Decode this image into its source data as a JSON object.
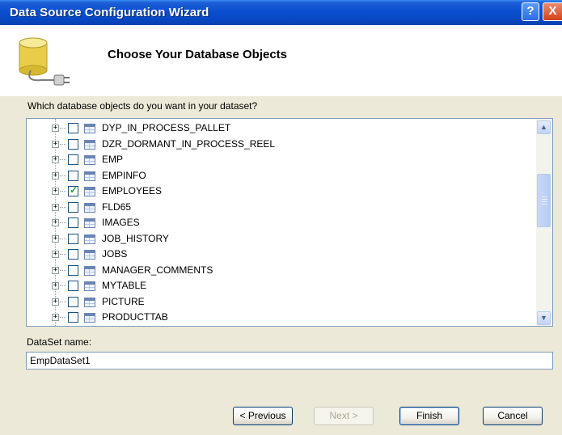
{
  "window": {
    "title": "Data Source Configuration Wizard",
    "help_label": "?",
    "close_label": "X"
  },
  "header": {
    "title": "Choose Your Database Objects"
  },
  "main": {
    "prompt": "Which database objects do you want in your dataset?",
    "tree_items": [
      {
        "label": "DYP_IN_PROCESS_PALLET",
        "checked": false
      },
      {
        "label": "DZR_DORMANT_IN_PROCESS_REEL",
        "checked": false
      },
      {
        "label": "EMP",
        "checked": false
      },
      {
        "label": "EMPINFO",
        "checked": false
      },
      {
        "label": "EMPLOYEES",
        "checked": true
      },
      {
        "label": "FLD65",
        "checked": false
      },
      {
        "label": "IMAGES",
        "checked": false
      },
      {
        "label": "JOB_HISTORY",
        "checked": false
      },
      {
        "label": "JOBS",
        "checked": false
      },
      {
        "label": "MANAGER_COMMENTS",
        "checked": false
      },
      {
        "label": "MYTABLE",
        "checked": false
      },
      {
        "label": "PICTURE",
        "checked": false
      },
      {
        "label": "PRODUCTTAB",
        "checked": false
      }
    ],
    "dataset_label": "DataSet name:",
    "dataset_value": "EmpDataSet1"
  },
  "footer": {
    "previous_label": "< Previous",
    "next_label": "Next >",
    "finish_label": "Finish",
    "cancel_label": "Cancel"
  },
  "icons": {
    "expander": "plus-icon",
    "table": "table-icon",
    "check": "checkmark-icon"
  }
}
